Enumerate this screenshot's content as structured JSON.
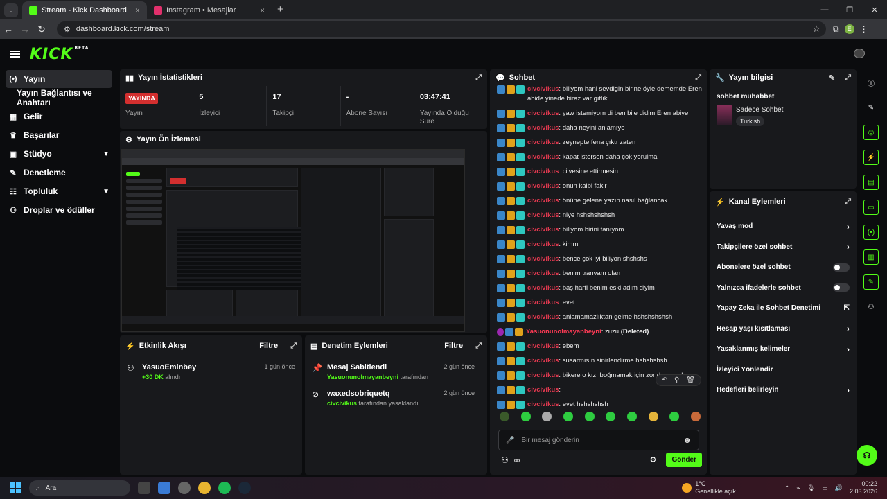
{
  "browser": {
    "tabs": [
      {
        "title": "Stream - Kick Dashboard",
        "active": true,
        "icon_color": "#53fc18"
      },
      {
        "title": "Instagram • Mesajlar",
        "active": false,
        "icon_color": "#e1306c"
      }
    ],
    "url": "dashboard.kick.com/stream",
    "profile_initial": "E"
  },
  "app": {
    "logo": "KICK",
    "logo_beta": "BETA"
  },
  "sidebar": {
    "items": [
      {
        "label": "Yayın",
        "icon": "broadcast-icon"
      },
      {
        "label": "Yayın Bağlantısı ve Anahtarı",
        "icon": ""
      },
      {
        "label": "Gelir",
        "icon": "chart-icon"
      },
      {
        "label": "Başarılar",
        "icon": "trophy-icon"
      },
      {
        "label": "Stüdyo",
        "icon": "studio-icon"
      },
      {
        "label": "Denetleme",
        "icon": "wrench-icon"
      },
      {
        "label": "Topluluk",
        "icon": "community-icon"
      },
      {
        "label": "Droplar ve ödüller",
        "icon": "drops-icon"
      }
    ]
  },
  "stats": {
    "title": "Yayın İstatistikleri",
    "live_badge": "YAYINDA",
    "items": [
      {
        "value": "",
        "label": "Yayın"
      },
      {
        "value": "5",
        "label": "İzleyici"
      },
      {
        "value": "17",
        "label": "Takipçi"
      },
      {
        "value": "-",
        "label": "Abone Sayısı"
      },
      {
        "value": "03:47:41",
        "label": "Yayında Olduğu Süre"
      }
    ]
  },
  "preview": {
    "title": "Yayın Ön İzlemesi"
  },
  "activity": {
    "title": "Etkinlik Akışı",
    "filter": "Filtre",
    "items": [
      {
        "name": "YasuoEminbey",
        "detail_highlight": "+30 DK",
        "detail": " alındı",
        "time": "1 gün önce"
      }
    ]
  },
  "moderation": {
    "title": "Denetim Eylemleri",
    "filter": "Filtre",
    "items": [
      {
        "title": "Mesaj Sabitlendi",
        "user": "Yasuonunolmayanbeyni",
        "suffix": " tarafından",
        "time": "2 gün önce"
      },
      {
        "title": "waxedsobriquetq",
        "user": "civcivikus",
        "suffix": " tarafından yasaklandı",
        "time": "2 gün önce"
      }
    ]
  },
  "chat": {
    "title": "Sohbet",
    "messages": [
      {
        "user": "civcivikus",
        "text": ": biliyom hani sevdigin birine öyle dememde Eren abide yinede biraz var gıtlık"
      },
      {
        "user": "civcivikus",
        "text": ": yaw istemiyom di ben bile didim Eren abiye"
      },
      {
        "user": "civcivikus",
        "text": ": daha neyini anlamıyo"
      },
      {
        "user": "civcivikus",
        "text": ": zeynepte fena çıktı zaten"
      },
      {
        "user": "civcivikus",
        "text": ": kapat istersen daha çok yorulma"
      },
      {
        "user": "civcivikus",
        "text": ": cilvesine ettirmesin"
      },
      {
        "user": "civcivikus",
        "text": ": onun kalbi fakir"
      },
      {
        "user": "civcivikus",
        "text": ": önüne gelene yazıp nasıl bağlancak"
      },
      {
        "user": "civcivikus",
        "text": ": niye hshshshshsh"
      },
      {
        "user": "civcivikus",
        "text": ": biliyom birini tanıyom"
      },
      {
        "user": "civcivikus",
        "text": ": kimmi"
      },
      {
        "user": "civcivikus",
        "text": ": bence çok iyi biliyon shshshs"
      },
      {
        "user": "civcivikus",
        "text": ": benim tranvam olan"
      },
      {
        "user": "civcivikus",
        "text": ": baş harfi benim eski adım diyim"
      },
      {
        "user": "civcivikus",
        "text": ": evet"
      },
      {
        "user": "civcivikus",
        "text": ": anlamamazlıktan gelme hshshshshsh"
      },
      {
        "user": "Yasuonunolmayanbeyni",
        "text": ": zuzu",
        "deleted": " (Deleted)"
      },
      {
        "user": "civcivikus",
        "text": ": ebem"
      },
      {
        "user": "civcivikus",
        "text": ": susarmısın sinirlendirme hshshshsh"
      },
      {
        "user": "civcivikus",
        "text": ": bikere o kızı boğmamak için zor duruyordum"
      },
      {
        "user": "civcivikus",
        "text": ":"
      },
      {
        "user": "civcivikus",
        "text": ": evet hshshshsh"
      }
    ],
    "input_placeholder": "Bir mesaj gönderin",
    "send_label": "Gönder"
  },
  "stream_info": {
    "title": "Yayın bilgisi",
    "stream_title": "sohbet muhabbet",
    "category": "Sadece Sohbet",
    "tag": "Turkish"
  },
  "channel_actions": {
    "title": "Kanal Eylemleri",
    "items": [
      {
        "label": "Yavaş mod",
        "control": "chevron"
      },
      {
        "label": "Takipçilere özel sohbet",
        "control": "chevron"
      },
      {
        "label": "Abonelere özel sohbet",
        "control": "toggle"
      },
      {
        "label": "Yalnızca ifadelerle sohbet",
        "control": "toggle"
      },
      {
        "label": "Yapay Zeka ile Sohbet Denetimi",
        "control": "external"
      },
      {
        "label": "Hesap yaşı kısıtlaması",
        "control": "chevron"
      },
      {
        "label": "Yasaklanmış kelimeler",
        "control": "chevron"
      },
      {
        "label": "İzleyici Yönlendir",
        "control": "none"
      },
      {
        "label": "Hedefleri belirleyin",
        "control": "chevron"
      }
    ]
  },
  "taskbar": {
    "search": "Ara",
    "weather_temp": "1°C",
    "weather_desc": "Genellikle açık",
    "time": "00:22",
    "date": "2.03.2026"
  },
  "colors": {
    "accent": "#53fc18",
    "live": "#d32f2f",
    "username": "#e53950"
  }
}
